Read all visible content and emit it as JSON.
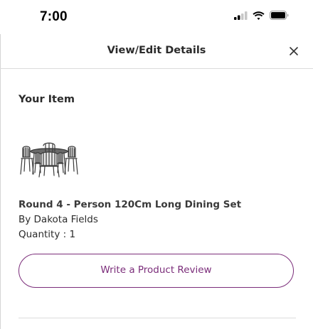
{
  "status_bar": {
    "time": "7:00",
    "icons": [
      "cellular-signal-icon",
      "wifi-icon",
      "battery-icon"
    ]
  },
  "header": {
    "title": "View/Edit Details",
    "close_icon": "close-icon"
  },
  "item_section": {
    "title": "Your Item",
    "product": {
      "image_icon": "dining-set-image",
      "name": "Round 4 - Person 120Cm Long Dining Set",
      "brand": "By Dakota Fields",
      "quantity": "Quantity : 1"
    },
    "review_button_label": "Write a Product Review"
  },
  "colors": {
    "accent": "#7b2d7a",
    "text": "#2b2b2b",
    "divider": "#dcdcdc"
  }
}
